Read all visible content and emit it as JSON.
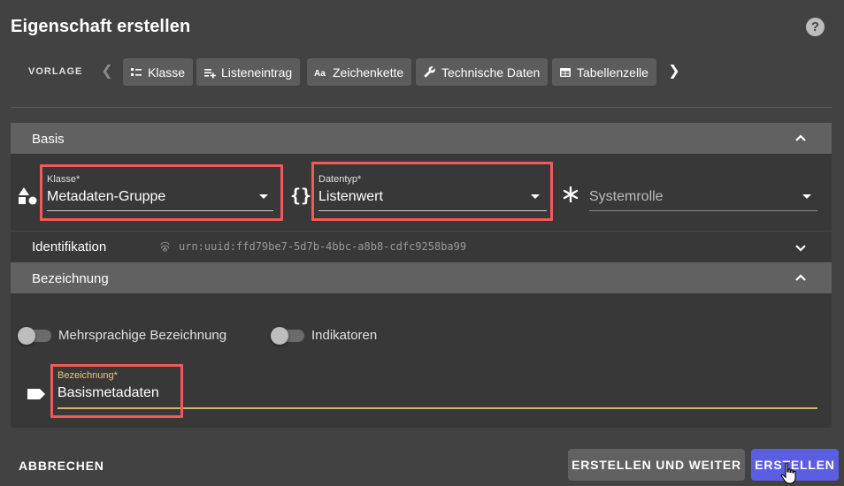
{
  "dialog": {
    "title": "Eigenschaft erstellen",
    "help_icon": "help-icon"
  },
  "templates": {
    "label": "VORLAGE",
    "items": [
      {
        "label": "Klasse",
        "icon": "class-icon"
      },
      {
        "label": "Listeneintrag",
        "icon": "playlist-add-icon"
      },
      {
        "label": "Zeichenkette",
        "icon": "text-aa-icon"
      },
      {
        "label": "Technische Daten",
        "icon": "wrench-icon"
      },
      {
        "label": "Tabellenzelle",
        "icon": "table-icon"
      }
    ]
  },
  "basis": {
    "header": "Basis",
    "klasse": {
      "label": "Klasse*",
      "value": "Metadaten-Gruppe",
      "icon": "shapes-icon"
    },
    "datentyp": {
      "label": "Datentyp*",
      "value": "Listenwert",
      "icon": "curly-braces-icon"
    },
    "systemrolle": {
      "placeholder": "Systemrolle",
      "icon": "asterisk-icon"
    }
  },
  "identifikation": {
    "header": "Identifikation",
    "value": "urn:uuid:ffd79be7-5d7b-4bbc-a8b8-cdfc9258ba99",
    "icon": "fingerprint-icon"
  },
  "bezeichnung": {
    "header": "Bezeichnung",
    "toggle_multilang": "Mehrsprachige Bezeichnung",
    "toggle_indicators": "Indikatoren",
    "field": {
      "label": "Bezeichnung*",
      "value": "Basismetadaten",
      "icon": "label-tag-icon"
    }
  },
  "footer": {
    "cancel": "ABBRECHEN",
    "create_continue": "ERSTELLEN UND WEITER",
    "create": "ERSTELLEN"
  },
  "colors": {
    "accent": "#5b5ee0",
    "highlight": "#f05a5a",
    "focus_underline": "#d4b766",
    "focus_label": "#e8c77a"
  }
}
